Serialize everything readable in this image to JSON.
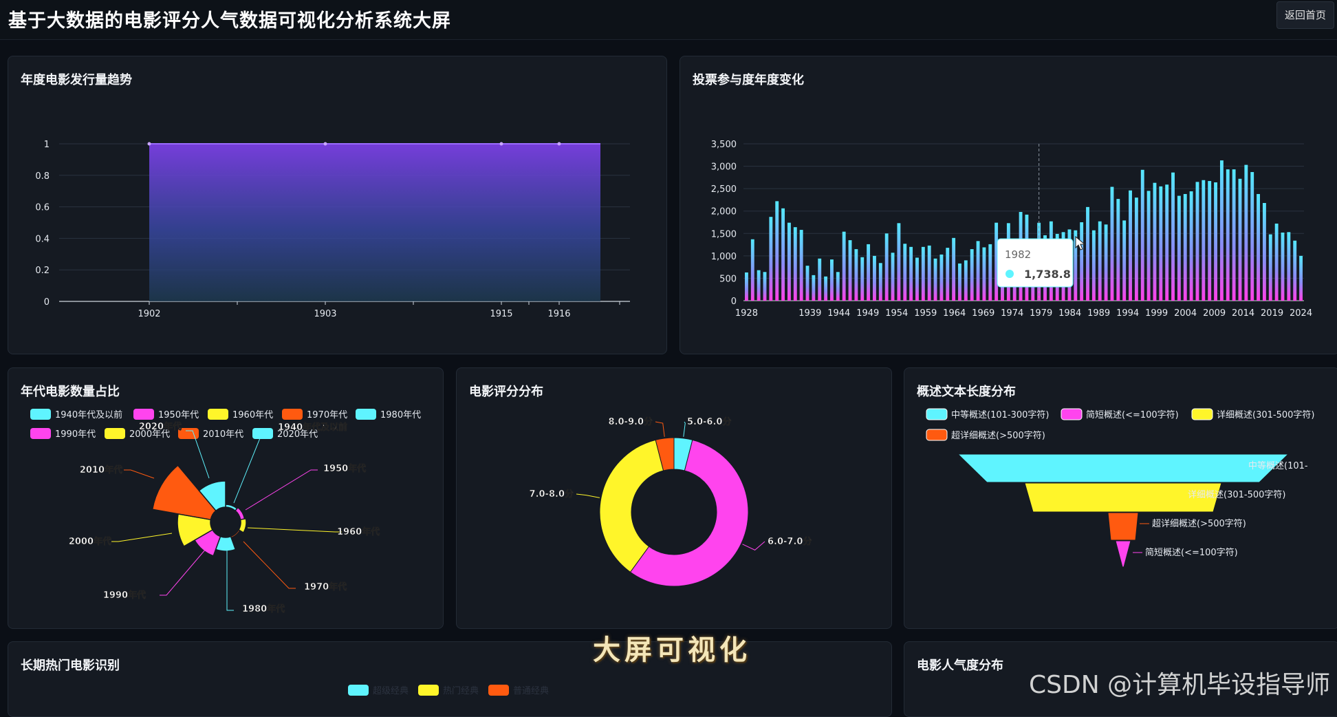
{
  "header": {
    "title": "基于大数据的电影评分人气数据可视化分析系统大屏",
    "home_button": "返回首页"
  },
  "panels": {
    "release_trend": {
      "title": "年度电影发行量趋势"
    },
    "vote_trend": {
      "title": "投票参与度年度变化"
    },
    "decade_share": {
      "title": "年代电影数量占比"
    },
    "rating_dist": {
      "title": "电影评分分布"
    },
    "summary_length": {
      "title": "概述文本长度分布"
    },
    "long_hot": {
      "title": "长期热门电影识别"
    },
    "people_pop": {
      "title": "电影人气度分布"
    }
  },
  "long_hot_legend": [
    "超级经典",
    "热门经典",
    "普通经典"
  ],
  "overlay": {
    "big_text": "大屏可视化",
    "watermark": "CSDN @计算机毕设指导师"
  },
  "colors": {
    "cyan": "#5ff4ff",
    "magenta": "#ff44ee",
    "yellow": "#fff52a",
    "orange": "#ff5a10",
    "purple": "#7b3fe4"
  },
  "chart_data": [
    {
      "id": "release",
      "type": "area",
      "x": [
        1902,
        1903,
        1915,
        1916
      ],
      "values": [
        1,
        1,
        1,
        1
      ],
      "yticks": [
        "0",
        "0.2",
        "0.4",
        "0.6",
        "0.8",
        "1"
      ],
      "ylim": [
        0,
        1
      ]
    },
    {
      "id": "votes",
      "type": "bar",
      "x_start": 1928,
      "x_end": 2024,
      "xticks": [
        "1928",
        "1939",
        "1944",
        "1949",
        "1954",
        "1959",
        "1964",
        "1969",
        "1974",
        "1979",
        "1984",
        "1989",
        "1994",
        "1999",
        "2004",
        "2009",
        "2014",
        "2019",
        "2024"
      ],
      "yticks": [
        "0",
        "500",
        "1,000",
        "1,500",
        "2,000",
        "2,500",
        "3,000",
        "3,500"
      ],
      "ylim": [
        0,
        3500
      ],
      "values": [
        630,
        1370,
        680,
        640,
        1870,
        2220,
        2060,
        1740,
        1640,
        1580,
        780,
        570,
        940,
        540,
        920,
        640,
        1540,
        1350,
        1150,
        970,
        1260,
        1000,
        840,
        1500,
        1070,
        1730,
        1270,
        1200,
        960,
        1200,
        1230,
        940,
        1030,
        1180,
        1400,
        830,
        900,
        1150,
        1330,
        1190,
        1260,
        1740,
        1120,
        1730,
        1290,
        1980,
        1920,
        1180,
        1738.8,
        1460,
        1770,
        1490,
        1530,
        1590,
        1570,
        1750,
        2090,
        1570,
        1770,
        1700,
        2540,
        2270,
        1790,
        2460,
        2300,
        2920,
        2450,
        2630,
        2550,
        2590,
        2860,
        2340,
        2380,
        2440,
        2650,
        2690,
        2670,
        2640,
        3130,
        2930,
        2930,
        2720,
        3030,
        2870,
        2380,
        2180,
        1480,
        1720,
        1520,
        1530,
        1340,
        1000
      ],
      "tooltip": {
        "label": "1982",
        "value": "1,738.8"
      }
    },
    {
      "id": "decade",
      "type": "pie",
      "legend": [
        "1940年代及以前",
        "1950年代",
        "1960年代",
        "1970年代",
        "1980年代",
        "1990年代",
        "2000年代",
        "2010年代",
        "2020年代"
      ],
      "labels": [
        "2020年代",
        "1940年代及以前",
        "1950年代",
        "1960年代",
        "1970年代",
        "1980年代",
        "1990年代",
        "2000年代",
        "2010年代"
      ]
    },
    {
      "id": "rating",
      "type": "pie",
      "slices": [
        {
          "label": "5.0-6.0分",
          "value": 4
        },
        {
          "label": "6.0-7.0分",
          "value": 56
        },
        {
          "label": "7.0-8.0分",
          "value": 36
        },
        {
          "label": "8.0-9.0分",
          "value": 4
        }
      ]
    },
    {
      "id": "summary",
      "type": "funnel",
      "legend": [
        "中等概述(101-300字符)",
        "简短概述(<=100字符)",
        "详细概述(301-500字符)",
        "超详细概述(>500字符)"
      ],
      "labels": [
        "中等概述(101-",
        "详细概述(301-500字符)",
        "超详细概述(>500字符)",
        "简短概述(<=100字符)"
      ]
    }
  ]
}
